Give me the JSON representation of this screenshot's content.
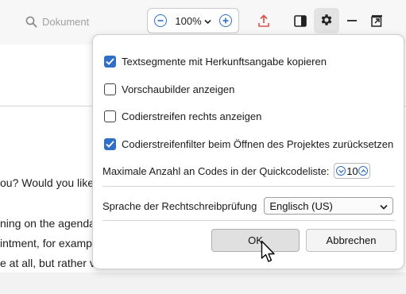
{
  "toolbar": {
    "search_placeholder": "Dokument",
    "zoom_value": "100%",
    "icons": [
      "search-icon",
      "zoom-out-icon",
      "chevron-down-icon",
      "zoom-in-icon",
      "export-icon",
      "panel-toggle-icon",
      "gear-icon",
      "minimize-icon",
      "undock-icon"
    ],
    "accent_color": "#2d6fc4",
    "export_icon_color": "#d9534f"
  },
  "document": {
    "lines": [
      "ou? Would you like",
      "ning on the agenda",
      "intment, for examp",
      "e at all, but rather v"
    ]
  },
  "dialog": {
    "options": [
      {
        "label": "Textsegmente mit Herkunftsangabe kopieren",
        "checked": true
      },
      {
        "label": "Vorschaubilder anzeigen",
        "checked": false
      },
      {
        "label": "Codierstreifen rechts anzeigen",
        "checked": false
      },
      {
        "label": "Codierstreifenfilter beim Öffnen des Projektes zurücksetzen",
        "checked": true
      }
    ],
    "quickcode_label": "Maximale Anzahl an Codes in der Quickcodeliste:",
    "quickcode_value": "10",
    "spellcheck_label": "Sprache der Rechtschreibprüfung",
    "spellcheck_value": "Englisch (US)",
    "ok_label": "OK",
    "cancel_label": "Abbrechen",
    "checkbox_color": "#2f6fc6"
  }
}
